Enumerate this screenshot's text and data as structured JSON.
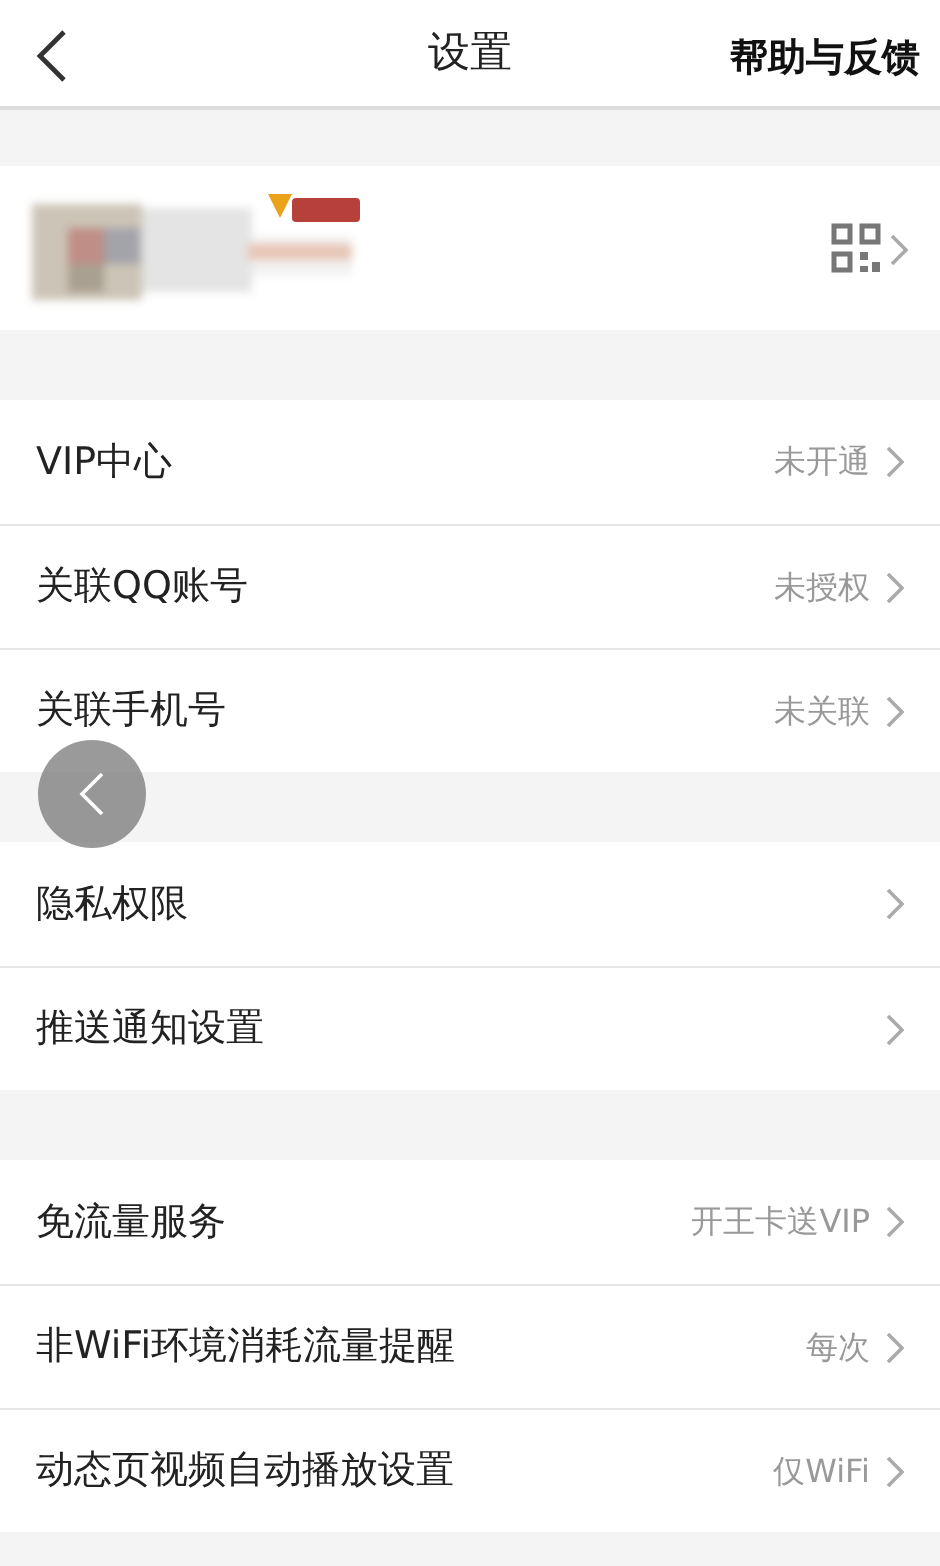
{
  "header": {
    "title": "设置",
    "action": "帮助与反馈"
  },
  "groups": [
    {
      "items": [
        {
          "label": "VIP中心",
          "value": "未开通"
        },
        {
          "label": "关联QQ账号",
          "value": "未授权"
        },
        {
          "label": "关联手机号",
          "value": "未关联"
        }
      ]
    },
    {
      "items": [
        {
          "label": "隐私权限"
        },
        {
          "label": "推送通知设置"
        }
      ]
    },
    {
      "items": [
        {
          "label": "免流量服务",
          "value": "开王卡送VIP"
        },
        {
          "label": "非WiFi环境消耗流量提醒",
          "value": "每次"
        },
        {
          "label": "动态页视频自动播放设置",
          "value": "仅WiFi"
        }
      ]
    }
  ]
}
